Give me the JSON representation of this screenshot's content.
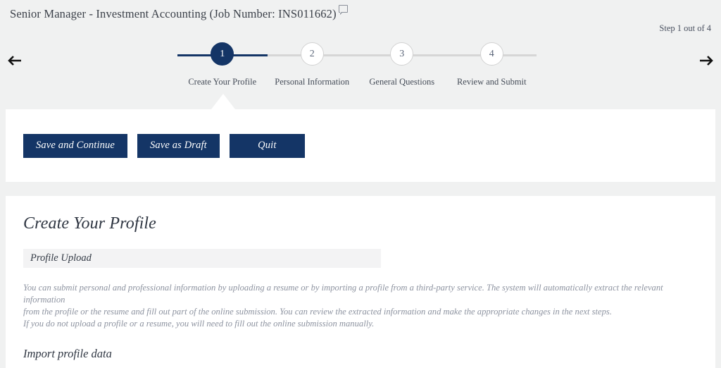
{
  "header": {
    "job_title": "Senior Manager - Investment Accounting (Job Number: INS011662)",
    "comment_icon": "comment-bubble-icon",
    "step_counter": "Step 1 out of 4",
    "prev_arrow_icon": "arrow-left-icon",
    "next_arrow_icon": "arrow-right-icon"
  },
  "stepper": {
    "current_step": 1,
    "total_steps": 4,
    "active_color": "#143566",
    "inactive_color": "#d2d2d2",
    "steps": [
      {
        "number": "1",
        "label": "Create Your Profile"
      },
      {
        "number": "2",
        "label": "Personal Information"
      },
      {
        "number": "3",
        "label": "General Questions"
      },
      {
        "number": "4",
        "label": "Review and Submit"
      }
    ]
  },
  "actions": {
    "save_continue_label": "Save and Continue",
    "save_draft_label": "Save as Draft",
    "quit_label": "Quit"
  },
  "content": {
    "title": "Create Your Profile",
    "section_header": "Profile Upload",
    "paragraph_line_1": "You can submit personal and professional information by uploading a resume or by importing a profile from a third-party service. The system will automatically extract the relevant information",
    "paragraph_line_2": "from the profile or the resume and fill out part of the online submission. You can review the extracted information and make the appropriate changes in the next steps.",
    "paragraph_line_3": "If you do not upload a profile or a resume, you will need to fill out the online submission manually.",
    "subsection_title": "Import profile data"
  }
}
